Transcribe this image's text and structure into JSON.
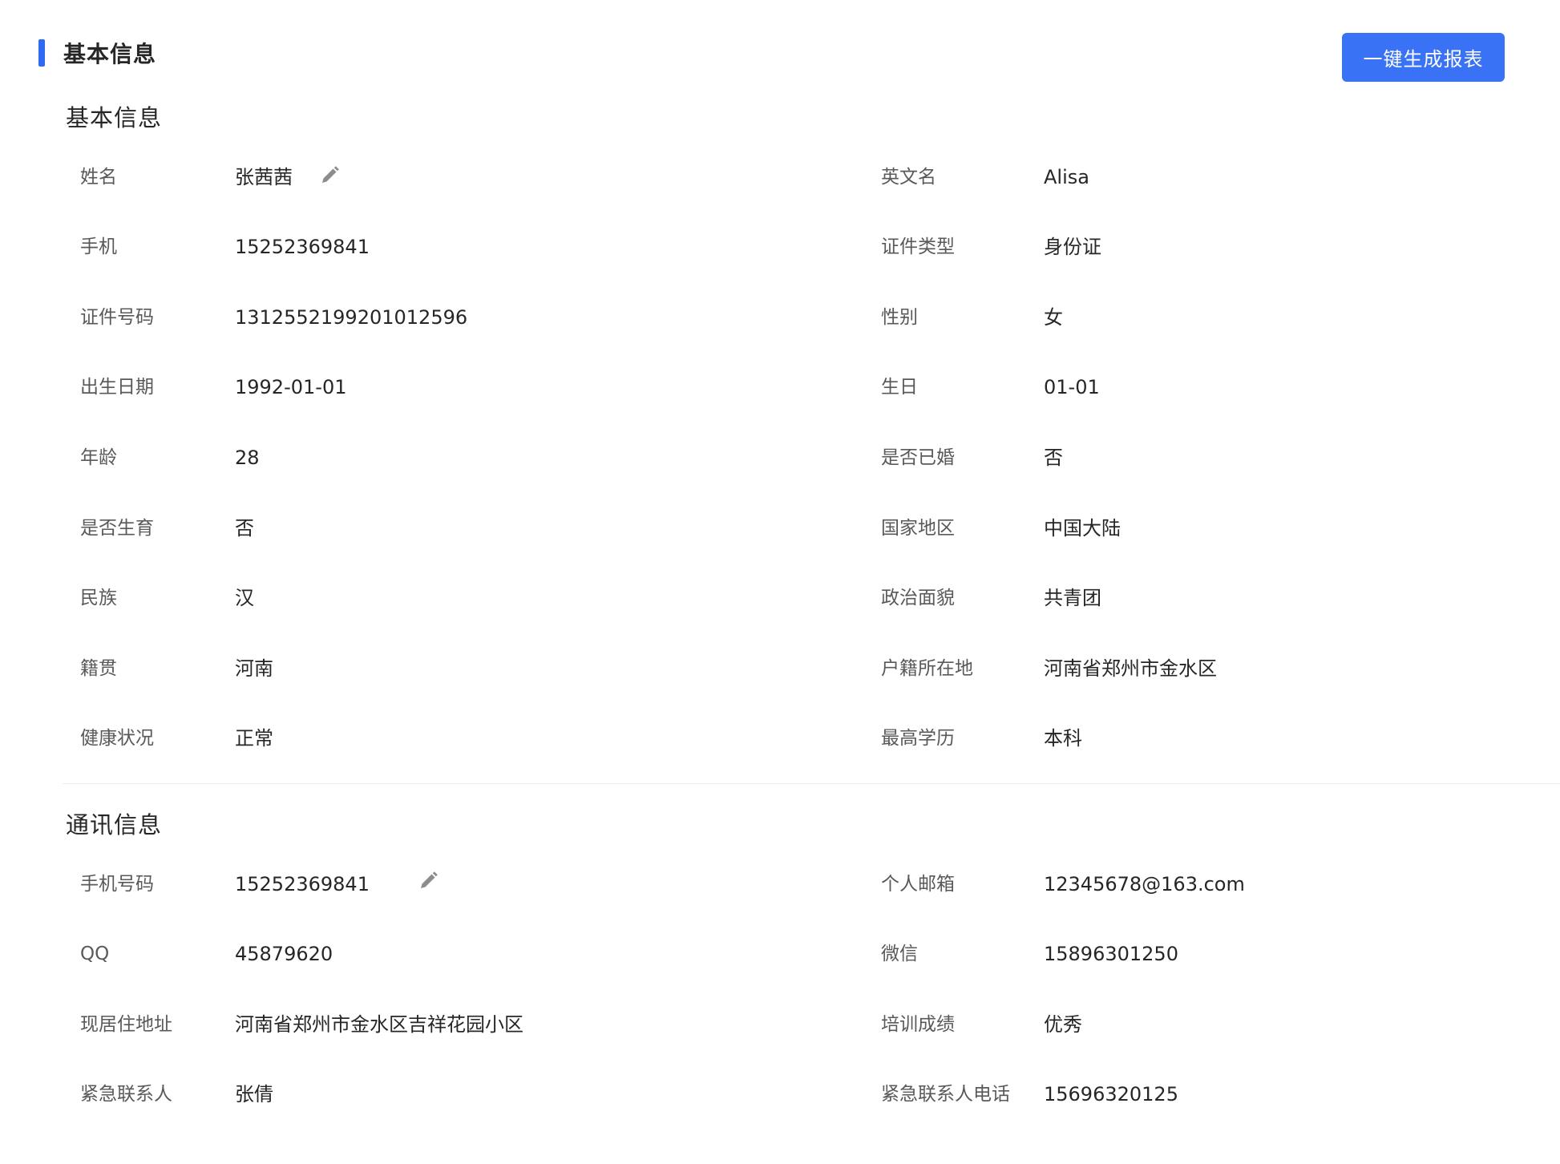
{
  "header": {
    "title": "基本信息",
    "generate_button_label": "一键生成报表"
  },
  "sections": {
    "basic": {
      "title": "基本信息",
      "rows": [
        {
          "left_label": "姓名",
          "left_value": "张茜茜",
          "right_label": "英文名",
          "right_value": "Alisa"
        },
        {
          "left_label": "手机",
          "left_value": "15252369841",
          "right_label": "证件类型",
          "right_value": "身份证"
        },
        {
          "left_label": "证件号码",
          "left_value": "131255219920101259​6",
          "right_label": "性别",
          "right_value": "女"
        },
        {
          "left_label": "出生日期",
          "left_value": "1992-01-01",
          "right_label": "生日",
          "right_value": "01-01"
        },
        {
          "left_label": "年龄",
          "left_value": "28",
          "right_label": "是否已婚",
          "right_value": "否"
        },
        {
          "left_label": "是否生育",
          "left_value": "否",
          "right_label": "国家地区",
          "right_value": "中国大陆"
        },
        {
          "left_label": "民族",
          "left_value": "汉",
          "right_label": "政治面貌",
          "right_value": "共青团"
        },
        {
          "left_label": "籍贯",
          "left_value": "河南",
          "right_label": "户籍所在地",
          "right_value": "河南省郑州市金水区"
        },
        {
          "left_label": "健康状况",
          "left_value": "正常",
          "right_label": "最高学历",
          "right_value": "本科"
        }
      ]
    },
    "contact": {
      "title": "通讯信息",
      "rows": [
        {
          "left_label": "手机号码",
          "left_value": "15252369841",
          "right_label": "个人邮箱",
          "right_value": "12345678@163.com"
        },
        {
          "left_label": "QQ",
          "left_value": "45879620",
          "right_label": "微信",
          "right_value": "15896301250"
        },
        {
          "left_label": "现居住地址",
          "left_value": "河南省郑州市金水区吉祥花园小区",
          "right_label": "培训成绩",
          "right_value": "优秀"
        },
        {
          "left_label": "紧急联系人",
          "left_value": "张倩",
          "right_label": "紧急联系人电话",
          "right_value": "15696320125"
        }
      ]
    }
  },
  "icons": {
    "edit": "pencil-edit-icon"
  },
  "colors": {
    "accent": "#2f6bf2",
    "button": "#3a72f5",
    "label": "#595959",
    "value": "#262626"
  }
}
